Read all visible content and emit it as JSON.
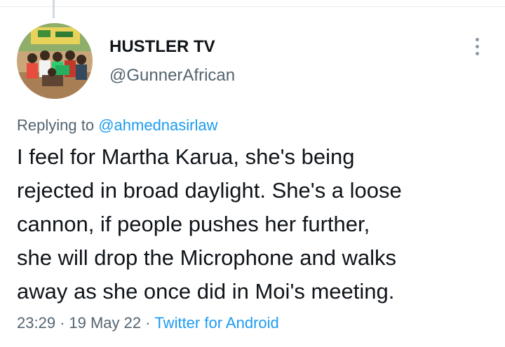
{
  "tweet": {
    "author": {
      "display_name": "HUSTLER TV",
      "handle": "@GunnerAfrican",
      "avatar_icon": "group-photo-avatar"
    },
    "reply": {
      "prefix": "Replying to",
      "mention": "@ahmednasirlaw"
    },
    "text_lines": [
      "I feel for Martha Karua, she's being",
      "rejected in broad daylight. She's a loose",
      "cannon, if people pushes her further,",
      "she will drop the Microphone and walks",
      "away as she once did in Moi's meeting."
    ],
    "meta": {
      "time": "23:29",
      "separator": "·",
      "date": "19 May 22",
      "source": "Twitter for Android"
    },
    "more_icon": "more-vertical-icon"
  },
  "colors": {
    "text": "#0f1419",
    "secondary": "#536471",
    "link": "#1d9bf0",
    "divider": "#e6ecf0"
  }
}
